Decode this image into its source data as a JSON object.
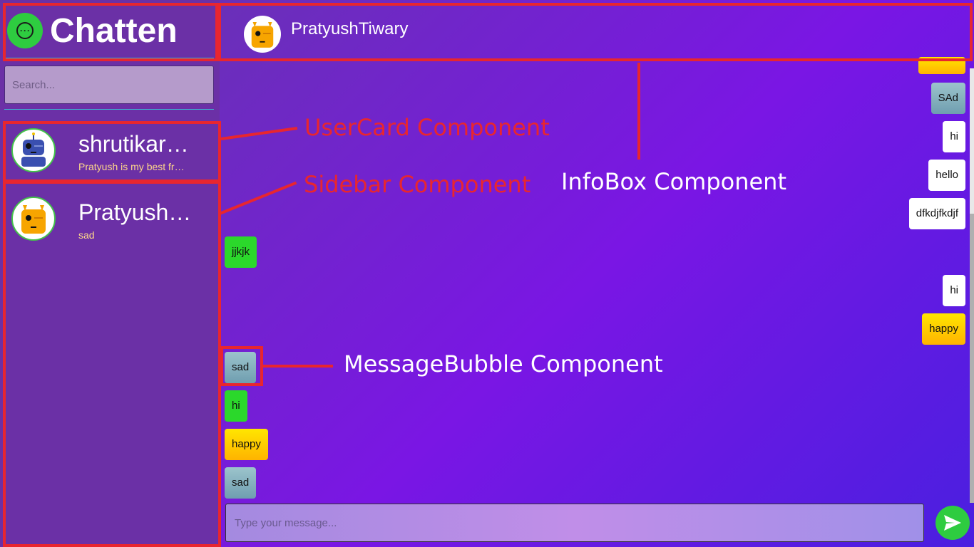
{
  "app": {
    "title": "Chatten",
    "brand_color": "#2ecc40"
  },
  "search": {
    "placeholder": "Search..."
  },
  "sidebar": {
    "users": [
      {
        "name": "shrutikar…",
        "last_message": "Pratyush is my best fr…",
        "avatar": "blue-robot-avatar"
      },
      {
        "name": "Pratyush…",
        "last_message": "sad",
        "avatar": "orange-robot-avatar"
      }
    ]
  },
  "chat": {
    "header": {
      "name": "PratyushTiwary",
      "avatar": "orange-robot-avatar"
    },
    "messages": [
      {
        "text": "SAd",
        "side": "right",
        "color": "blue"
      },
      {
        "text": "hi",
        "side": "right",
        "color": "white"
      },
      {
        "text": "hello",
        "side": "right",
        "color": "white"
      },
      {
        "text": "dfkdjfkdjf",
        "side": "right",
        "color": "white"
      },
      {
        "text": "jjkjk",
        "side": "left",
        "color": "green"
      },
      {
        "text": "hi",
        "side": "right",
        "color": "white"
      },
      {
        "text": "happy",
        "side": "right",
        "color": "yellow"
      },
      {
        "text": "sad",
        "side": "left",
        "color": "blue"
      },
      {
        "text": "hi",
        "side": "left",
        "color": "green"
      },
      {
        "text": "happy",
        "side": "left",
        "color": "yellow"
      },
      {
        "text": "sad",
        "side": "left",
        "color": "blue"
      }
    ],
    "composer": {
      "placeholder": "Type your message..."
    },
    "send_icon": "send-arrow-icon"
  },
  "annotations": {
    "usercard": "UserCard Component",
    "sidebar": "Sidebar Component",
    "infobox": "InfoBox Component",
    "messagebubble": "MessageBubble Component",
    "color": "#e8262f"
  }
}
